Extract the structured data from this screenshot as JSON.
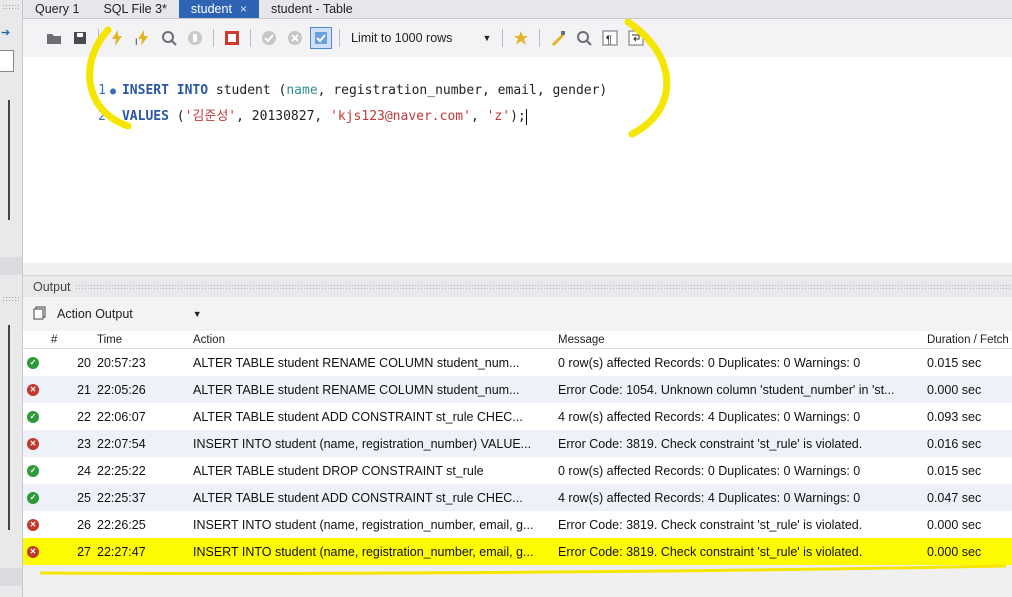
{
  "tabs": [
    {
      "label": "Query 1",
      "active": false
    },
    {
      "label": "SQL File 3*",
      "active": false
    },
    {
      "label": "student",
      "active": true,
      "close": "×"
    },
    {
      "label": "student - Table",
      "active": false
    }
  ],
  "toolbar": {
    "limit_label": "Limit to 1000 rows",
    "icons": [
      "folder-icon",
      "save-icon",
      "execute-icon",
      "execute-current-icon",
      "explain-icon",
      "stop-icon",
      "stop-on-error-icon",
      "commit-icon",
      "rollback-icon",
      "autocommit-icon",
      "beautify-icon",
      "find-icon",
      "invisible-chars-icon",
      "wrap-icon"
    ]
  },
  "editor": {
    "lines": [
      {
        "number": "1",
        "marker": "●",
        "tokens": [
          {
            "t": "INSERT",
            "k": "kw"
          },
          {
            "t": " ",
            "k": "id"
          },
          {
            "t": "INTO",
            "k": "kw"
          },
          {
            "t": " student (",
            "k": "id"
          },
          {
            "t": "name",
            "k": "col"
          },
          {
            "t": ", registration_number, email, gender)",
            "k": "id"
          }
        ]
      },
      {
        "number": "2",
        "marker": "",
        "tokens": [
          {
            "t": "VALUES",
            "k": "kw"
          },
          {
            "t": " (",
            "k": "id"
          },
          {
            "t": "'김준성'",
            "k": "str"
          },
          {
            "t": ", 20130827, ",
            "k": "num"
          },
          {
            "t": "'kjs123@naver.com'",
            "k": "str"
          },
          {
            "t": ", ",
            "k": "id"
          },
          {
            "t": "'z'",
            "k": "str"
          },
          {
            "t": ");",
            "k": "id"
          }
        ]
      }
    ]
  },
  "output": {
    "title": "Output",
    "selector": "Action Output",
    "columns": {
      "num": "#",
      "time": "Time",
      "action": "Action",
      "message": "Message",
      "duration": "Duration / Fetch"
    },
    "rows": [
      {
        "status": "ok",
        "num": "20",
        "time": "20:57:23",
        "action": "ALTER TABLE student  RENAME COLUMN student_num...",
        "message": "0 row(s) affected Records: 0  Duplicates: 0  Warnings: 0",
        "duration": "0.015 sec"
      },
      {
        "status": "error",
        "num": "21",
        "time": "22:05:26",
        "action": "ALTER TABLE student  RENAME COLUMN student_num...",
        "message": "Error Code: 1054. Unknown column 'student_number' in 'st...",
        "duration": "0.000 sec"
      },
      {
        "status": "ok",
        "num": "22",
        "time": "22:06:07",
        "action": "ALTER TABLE student ADD CONSTRAINT st_rule CHEC...",
        "message": "4 row(s) affected Records: 4  Duplicates: 0  Warnings: 0",
        "duration": "0.093 sec"
      },
      {
        "status": "error",
        "num": "23",
        "time": "22:07:54",
        "action": "INSERT INTO student (name, registration_number) VALUE...",
        "message": "Error Code: 3819. Check constraint 'st_rule' is violated.",
        "duration": "0.016 sec"
      },
      {
        "status": "ok",
        "num": "24",
        "time": "22:25:22",
        "action": "ALTER TABLE student DROP CONSTRAINT st_rule",
        "message": "0 row(s) affected Records: 0  Duplicates: 0  Warnings: 0",
        "duration": "0.015 sec"
      },
      {
        "status": "ok",
        "num": "25",
        "time": "22:25:37",
        "action": "ALTER TABLE student ADD CONSTRAINT st_rule CHEC...",
        "message": "4 row(s) affected Records: 4  Duplicates: 0  Warnings: 0",
        "duration": "0.047 sec"
      },
      {
        "status": "error",
        "num": "26",
        "time": "22:26:25",
        "action": "INSERT INTO student (name, registration_number, email, g...",
        "message": "Error Code: 3819. Check constraint 'st_rule' is violated.",
        "duration": "0.000 sec"
      },
      {
        "status": "error",
        "num": "27",
        "time": "22:27:47",
        "action": "INSERT INTO student (name, registration_number, email, g...",
        "message": "Error Code: 3819. Check constraint 'st_rule' is violated.",
        "duration": "0.000 sec",
        "highlighted": true
      }
    ]
  },
  "colors": {
    "accent": "#2f64b4",
    "annotation": "#f5e600",
    "ok": "#2e9a3a",
    "error": "#c0392b"
  }
}
